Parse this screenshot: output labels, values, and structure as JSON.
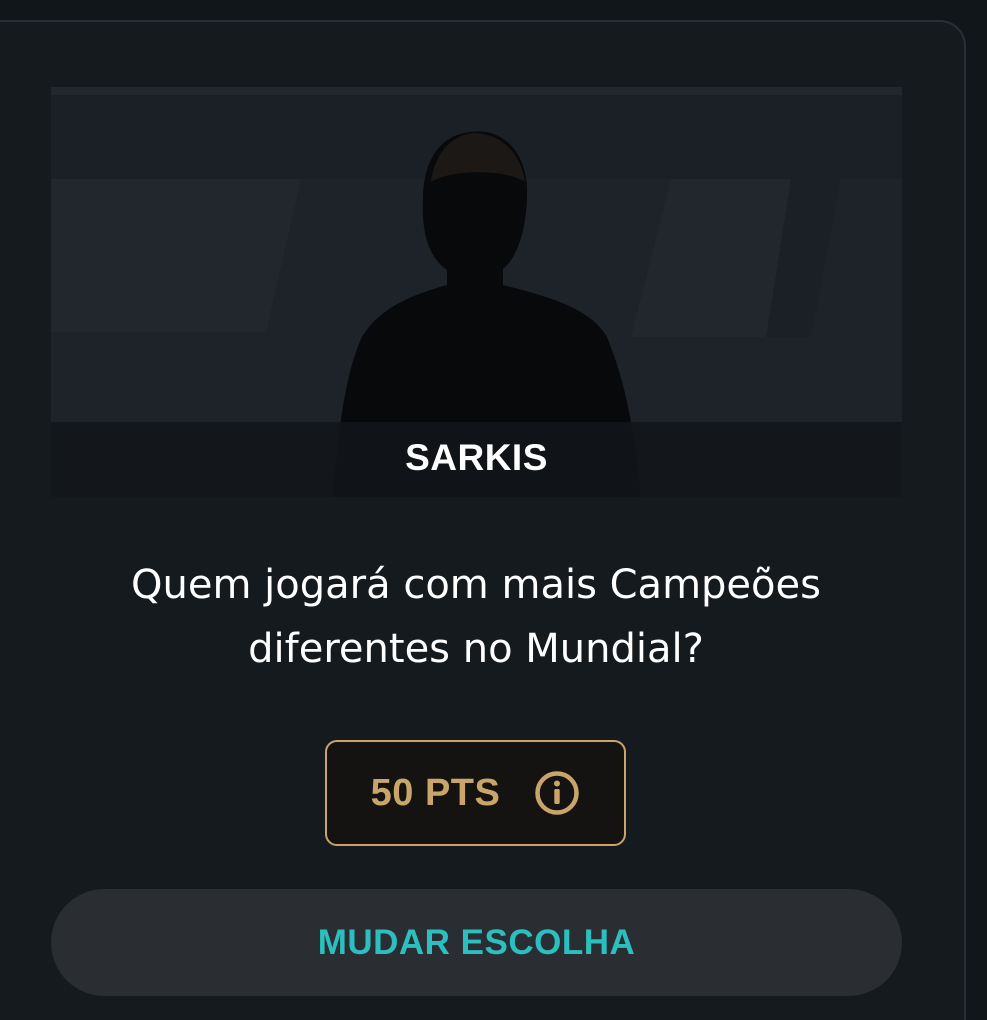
{
  "card": {
    "player_name": "SARKIS",
    "question": "Quem jogará com mais Campeões diferentes no Mundial?",
    "points_label": "50 PTS",
    "points_info_icon": "info-circle-icon",
    "change_choice_label": "MUDAR ESCOLHA"
  },
  "colors": {
    "background": "#11161b",
    "card": "#151a1f",
    "gold_accent": "#c9a56a",
    "teal_accent": "#2bbfbf",
    "button_bg": "#2a2e33"
  }
}
